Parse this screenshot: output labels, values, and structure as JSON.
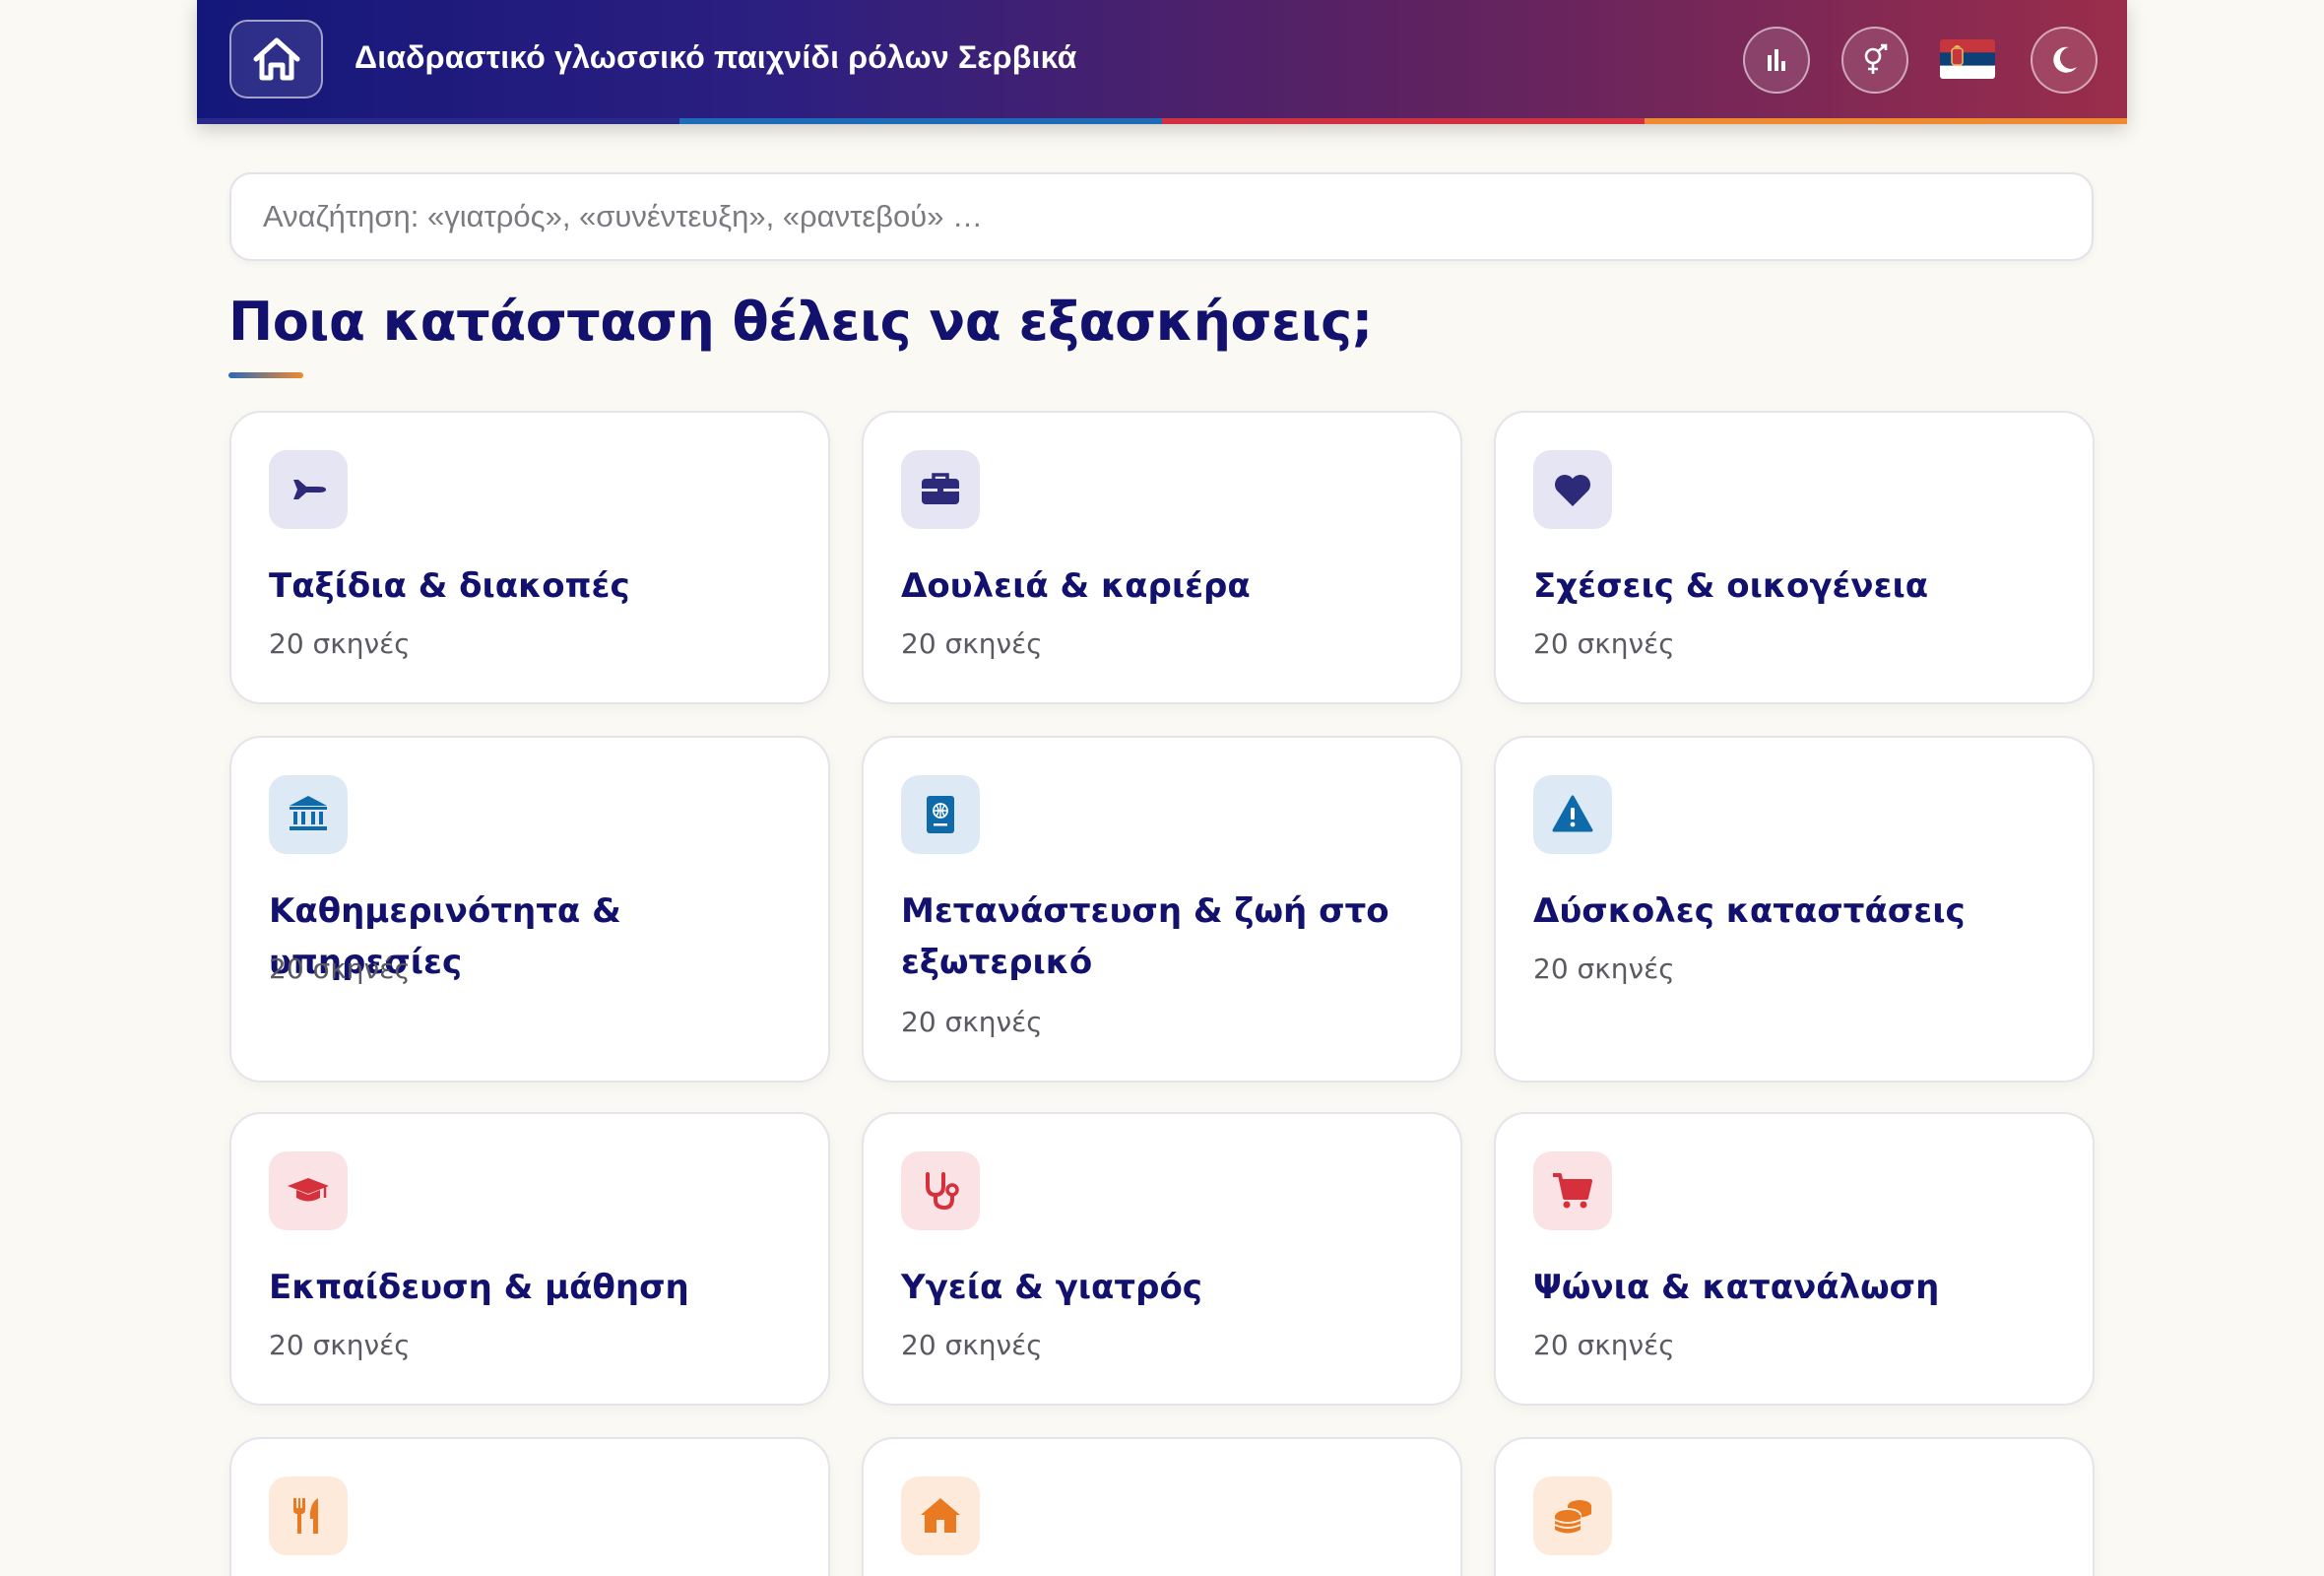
{
  "header": {
    "title": "Διαδραστικό γλωσσικό παιχνίδι ρόλων Σερβικά",
    "home_icon": "home-icon",
    "stats_icon": "bar-chart-icon",
    "gender_icon": "gender-icon",
    "flag_icon": "serbia-flag-icon",
    "theme_icon": "moon-icon"
  },
  "search": {
    "placeholder": "Αναζήτηση: «γιατρός», «συνέντευξη», «ραντεβού» …",
    "value": ""
  },
  "main": {
    "heading": "Ποια κατάσταση θέλεις να εξασκήσεις;"
  },
  "categories": [
    {
      "title": "Ταξίδια & διακοπές",
      "count": "20 σκηνές",
      "icon": "airplane-icon",
      "color": "#2d2a7a"
    },
    {
      "title": "Δουλειά & καριέρα",
      "count": "20 σκηνές",
      "icon": "briefcase-icon",
      "color": "#2d2a7a"
    },
    {
      "title": "Σχέσεις & οικογένεια",
      "count": "20 σκηνές",
      "icon": "heart-icon",
      "color": "#2d2a7a"
    },
    {
      "title": "Καθημερινότητα & υπηρεσίες",
      "count": "20 σκηνές",
      "icon": "bank-icon",
      "color": "#0e6aa8"
    },
    {
      "title": "Μετανάστευση & ζωή στο εξωτερικό",
      "count": "20 σκηνές",
      "icon": "passport-icon",
      "color": "#0e6aa8"
    },
    {
      "title": "Δύσκολες καταστάσεις",
      "count": "20 σκηνές",
      "icon": "warning-icon",
      "color": "#0e6aa8"
    },
    {
      "title": "Εκπαίδευση & μάθηση",
      "count": "20 σκηνές",
      "icon": "graduation-cap-icon",
      "color": "#d6303c"
    },
    {
      "title": "Υγεία & γιατρός",
      "count": "20 σκηνές",
      "icon": "stethoscope-icon",
      "color": "#d6303c"
    },
    {
      "title": "Ψώνια & κατανάλωση",
      "count": "20 σκηνές",
      "icon": "shopping-cart-icon",
      "color": "#d6303c"
    },
    {
      "title": "",
      "count": "",
      "icon": "utensils-icon",
      "color": "#ea7a22"
    },
    {
      "title": "",
      "count": "",
      "icon": "house-icon",
      "color": "#ea7a22"
    },
    {
      "title": "",
      "count": "",
      "icon": "coins-icon",
      "color": "#ea7a22"
    }
  ]
}
